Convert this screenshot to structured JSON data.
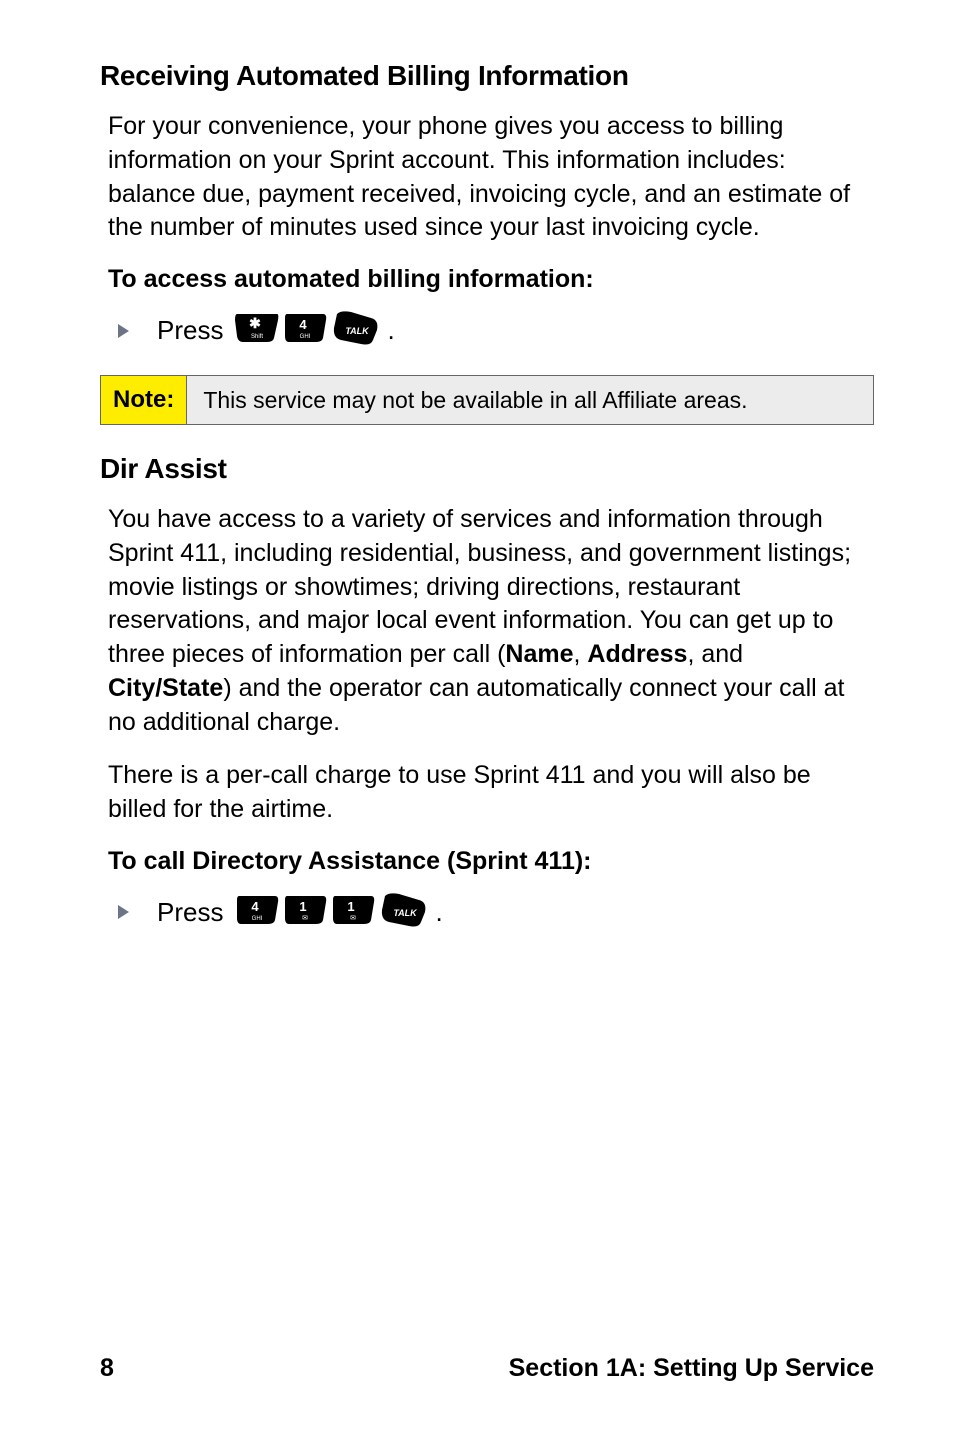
{
  "section1": {
    "heading": "Receiving Automated Billing Information",
    "body": "For your convenience, your phone gives you access to billing information on your Sprint account. This information includes: balance due, payment received, invoicing cycle, and an estimate of the number of minutes used since your last invoicing cycle.",
    "subhead": "To access automated billing information:",
    "press_label": "Press",
    "keys": [
      "star-key",
      "four-key",
      "talk-key"
    ],
    "note_label": "Note:",
    "note_text": "This service may not be available in all Affiliate areas."
  },
  "section2": {
    "heading": "Dir Assist",
    "body_parts": {
      "p1_before": "You have access to a variety of services and information through Sprint 411, including residential, business, and government listings; movie listings or showtimes; driving directions, restaurant reservations, and major local event information. You can get up to three pieces of information per call (",
      "name": "Name",
      "sep1": ", ",
      "address": "Address",
      "sep2": ", and ",
      "citystate": "City/State",
      "p1_after": ") and the operator can automatically connect your call at no additional charge."
    },
    "body2": "There is a per-call charge to use Sprint 411 and you will also be billed for the airtime.",
    "subhead": "To call Directory Assistance (Sprint 411):",
    "press_label": "Press",
    "keys": [
      "four-key",
      "one-key",
      "one-key",
      "talk-key"
    ]
  },
  "footer": {
    "page": "8",
    "section": "Section 1A: Setting Up Service"
  }
}
